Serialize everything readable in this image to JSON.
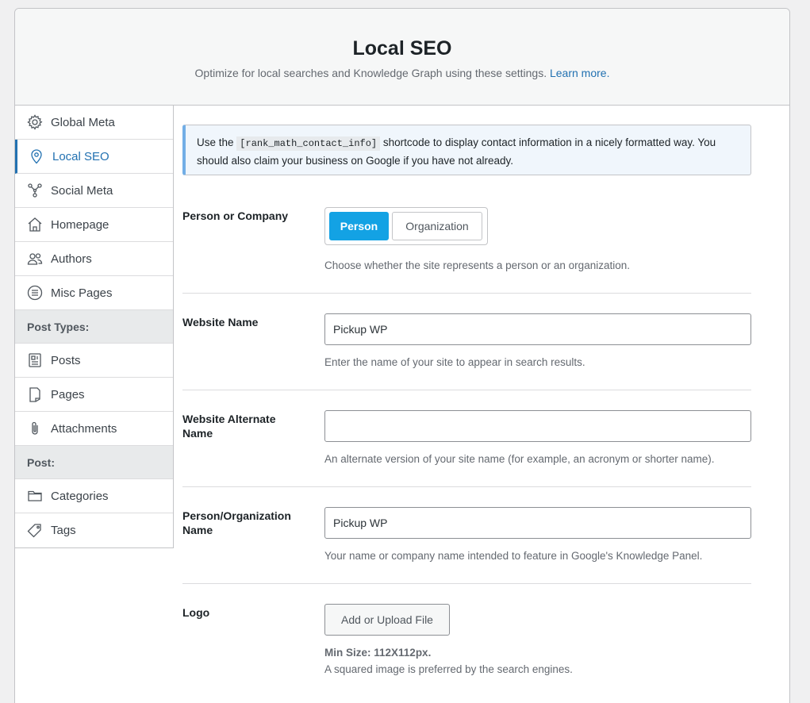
{
  "header": {
    "title": "Local SEO",
    "subtitle": "Optimize for local searches and Knowledge Graph using these settings.",
    "learn_more": "Learn more."
  },
  "sidebar": {
    "items": [
      {
        "label": "Global Meta",
        "icon": "gear-icon"
      },
      {
        "label": "Local SEO",
        "icon": "location-pin-icon",
        "active": true
      },
      {
        "label": "Social Meta",
        "icon": "social-nodes-icon"
      },
      {
        "label": "Homepage",
        "icon": "home-icon"
      },
      {
        "label": "Authors",
        "icon": "users-icon"
      },
      {
        "label": "Misc Pages",
        "icon": "list-circle-icon"
      }
    ],
    "post_types_heading": "Post Types:",
    "post_type_items": [
      {
        "label": "Posts",
        "icon": "post-icon"
      },
      {
        "label": "Pages",
        "icon": "page-icon"
      },
      {
        "label": "Attachments",
        "icon": "paperclip-icon"
      }
    ],
    "post_heading": "Post:",
    "post_items": [
      {
        "label": "Categories",
        "icon": "folder-icon"
      },
      {
        "label": "Tags",
        "icon": "tag-icon"
      }
    ]
  },
  "notice": {
    "prefix": "Use the",
    "shortcode": "[rank_math_contact_info]",
    "suffix": "shortcode to display contact information in a nicely formatted way. You should also claim your business on Google if you have not already."
  },
  "fields": {
    "person_or_company": {
      "label": "Person or Company",
      "options": [
        "Person",
        "Organization"
      ],
      "selected": "Person",
      "description": "Choose whether the site represents a person or an organization."
    },
    "website_name": {
      "label": "Website Name",
      "value": "Pickup WP",
      "description": "Enter the name of your site to appear in search results."
    },
    "website_alternate_name": {
      "label": "Website Alternate Name",
      "value": "",
      "description": "An alternate version of your site name (for example, an acronym or shorter name)."
    },
    "person_org_name": {
      "label": "Person/Organization Name",
      "value": "Pickup WP",
      "description": "Your name or company name intended to feature in Google's Knowledge Panel."
    },
    "logo": {
      "label": "Logo",
      "button": "Add or Upload File",
      "min_size": "Min Size: 112X112px.",
      "description": "A squared image is preferred by the search engines."
    }
  },
  "colors": {
    "accent": "#2271b1",
    "toggle_active": "#13a2e4"
  }
}
